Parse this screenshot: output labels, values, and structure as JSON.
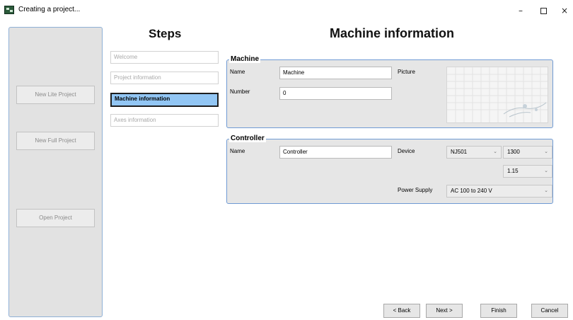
{
  "window": {
    "title": "Creating a project...",
    "controls": {
      "minimize": "–",
      "close": "×"
    }
  },
  "sidebar": {
    "buttons": [
      "New Lite Project",
      "New Full Project",
      "Open Project"
    ]
  },
  "steps": {
    "title": "Steps",
    "items": [
      "Welcome",
      "Project information",
      "Machine information",
      "Axes information"
    ],
    "active_index": 2
  },
  "page": {
    "title": "Machine information"
  },
  "machine": {
    "legend": "Machine",
    "name_label": "Name",
    "name_value": "Machine",
    "number_label": "Number",
    "number_value": "0",
    "picture_label": "Picture"
  },
  "controller": {
    "legend": "Controller",
    "name_label": "Name",
    "name_value": "Controller",
    "device_label": "Device",
    "device_value": "NJ501",
    "model_value": "1300",
    "version_value": "1.15",
    "power_supply_label": "Power Supply",
    "power_supply_value": "AC 100 to 240 V"
  },
  "footer": {
    "back": "< Back",
    "next": "Next >",
    "finish": "Finish",
    "cancel": "Cancel"
  },
  "icons": {
    "dropdown": "chevron-down-icon"
  },
  "colors": {
    "active_step": "#92c6f4",
    "group_border": "#6f9ad4",
    "panel_bg": "#e2e2e2"
  }
}
